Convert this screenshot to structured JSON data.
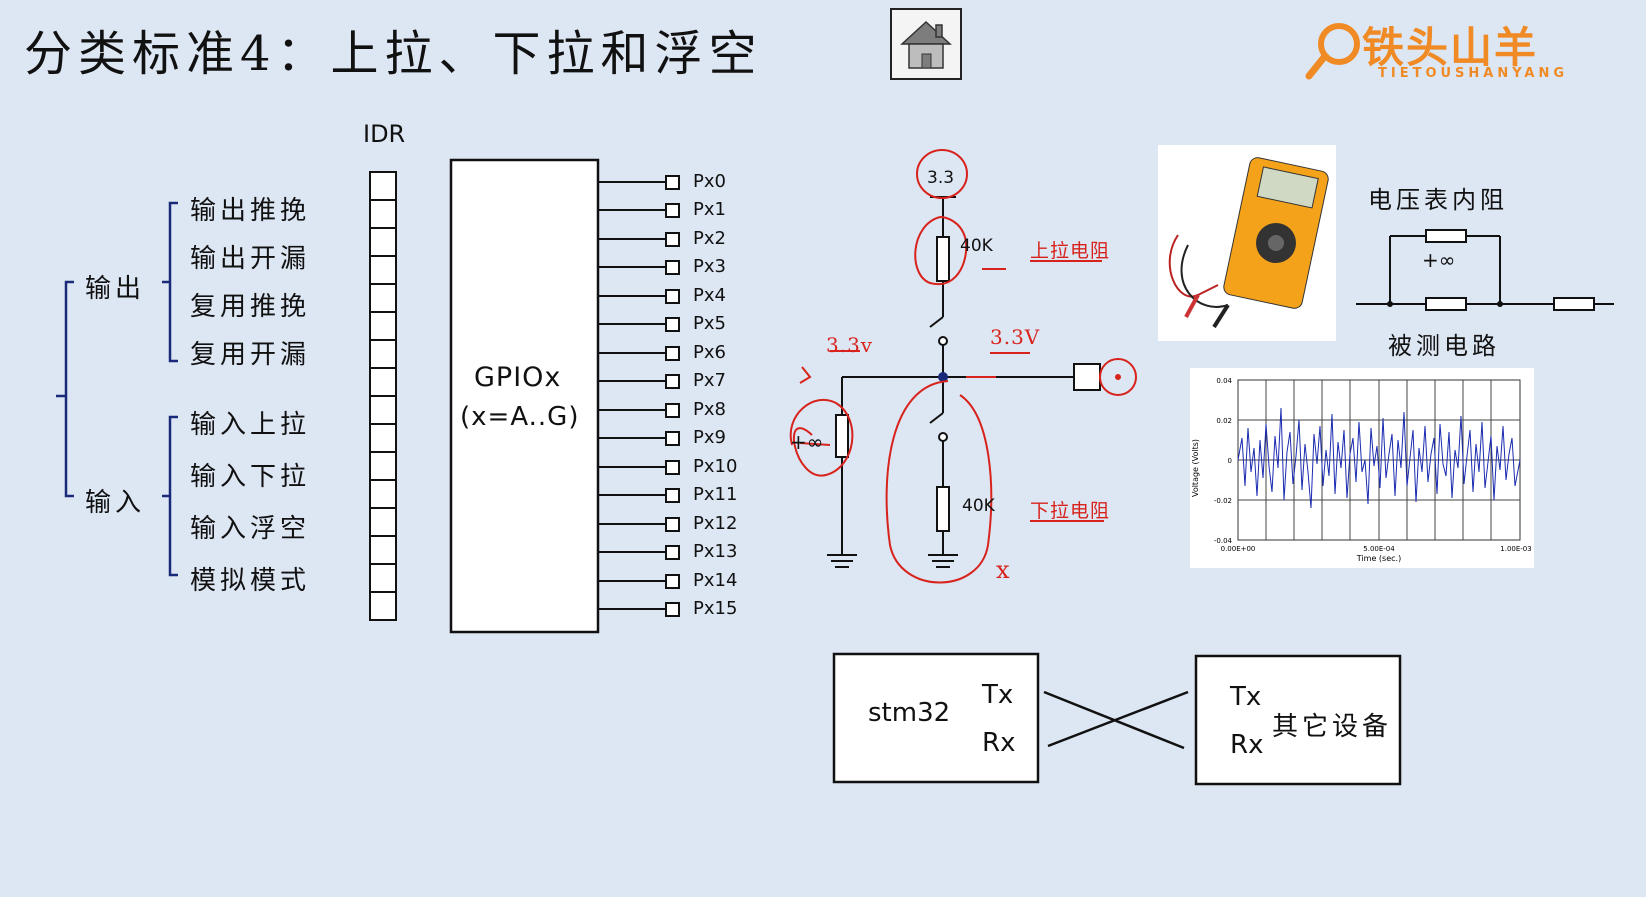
{
  "title": "分类标准4：上拉、下拉和浮空",
  "logo": {
    "name": "铁头山羊",
    "sub": "TIETOUSHANYANG"
  },
  "tree": {
    "output": {
      "label": "输出",
      "items": [
        "输出推挽",
        "输出开漏",
        "复用推挽",
        "复用开漏"
      ]
    },
    "input": {
      "label": "输入",
      "items": [
        "输入上拉",
        "输入下拉",
        "输入浮空",
        "模拟模式"
      ]
    }
  },
  "idr_label": "IDR",
  "gpio": {
    "name": "GPIOx",
    "range": "(x=A..G)"
  },
  "pins": [
    "Px0",
    "Px1",
    "Px2",
    "Px3",
    "Px4",
    "Px5",
    "Px6",
    "Px7",
    "Px8",
    "Px9",
    "Px10",
    "Px11",
    "Px12",
    "Px13",
    "Px14",
    "Px15"
  ],
  "circuit": {
    "vcc": "3.3",
    "r_up": "40K",
    "r_down": "40K",
    "pullup_note": "上拉电阻",
    "pulldown_note": "下拉电阻",
    "v_left": "3.3v",
    "v_right": "3.3V",
    "inf": "+∞",
    "cross": "x"
  },
  "voltmeter": {
    "title": "电压表内阻",
    "inf": "+∞",
    "caption": "被测电路"
  },
  "noise_plot": {
    "ylabel": "Voltage (Volts)",
    "xlabel": "Time (sec.)",
    "yticks": [
      "0.04",
      "0.02",
      "0",
      "-0.02",
      "-0.04"
    ],
    "xticks": [
      "0.00E+00",
      "5.00E-04",
      "1.00E-03"
    ]
  },
  "uart": {
    "left": {
      "name": "stm32",
      "tx": "Tx",
      "rx": "Rx"
    },
    "right": {
      "name": "其它设备",
      "tx": "Tx",
      "rx": "Rx"
    }
  },
  "colors": {
    "background": "#dde6f3",
    "bracket": "#1a2a7a",
    "annotation": "#d8231c",
    "logo": "#f08a24",
    "noise": "#1a2bb0"
  }
}
